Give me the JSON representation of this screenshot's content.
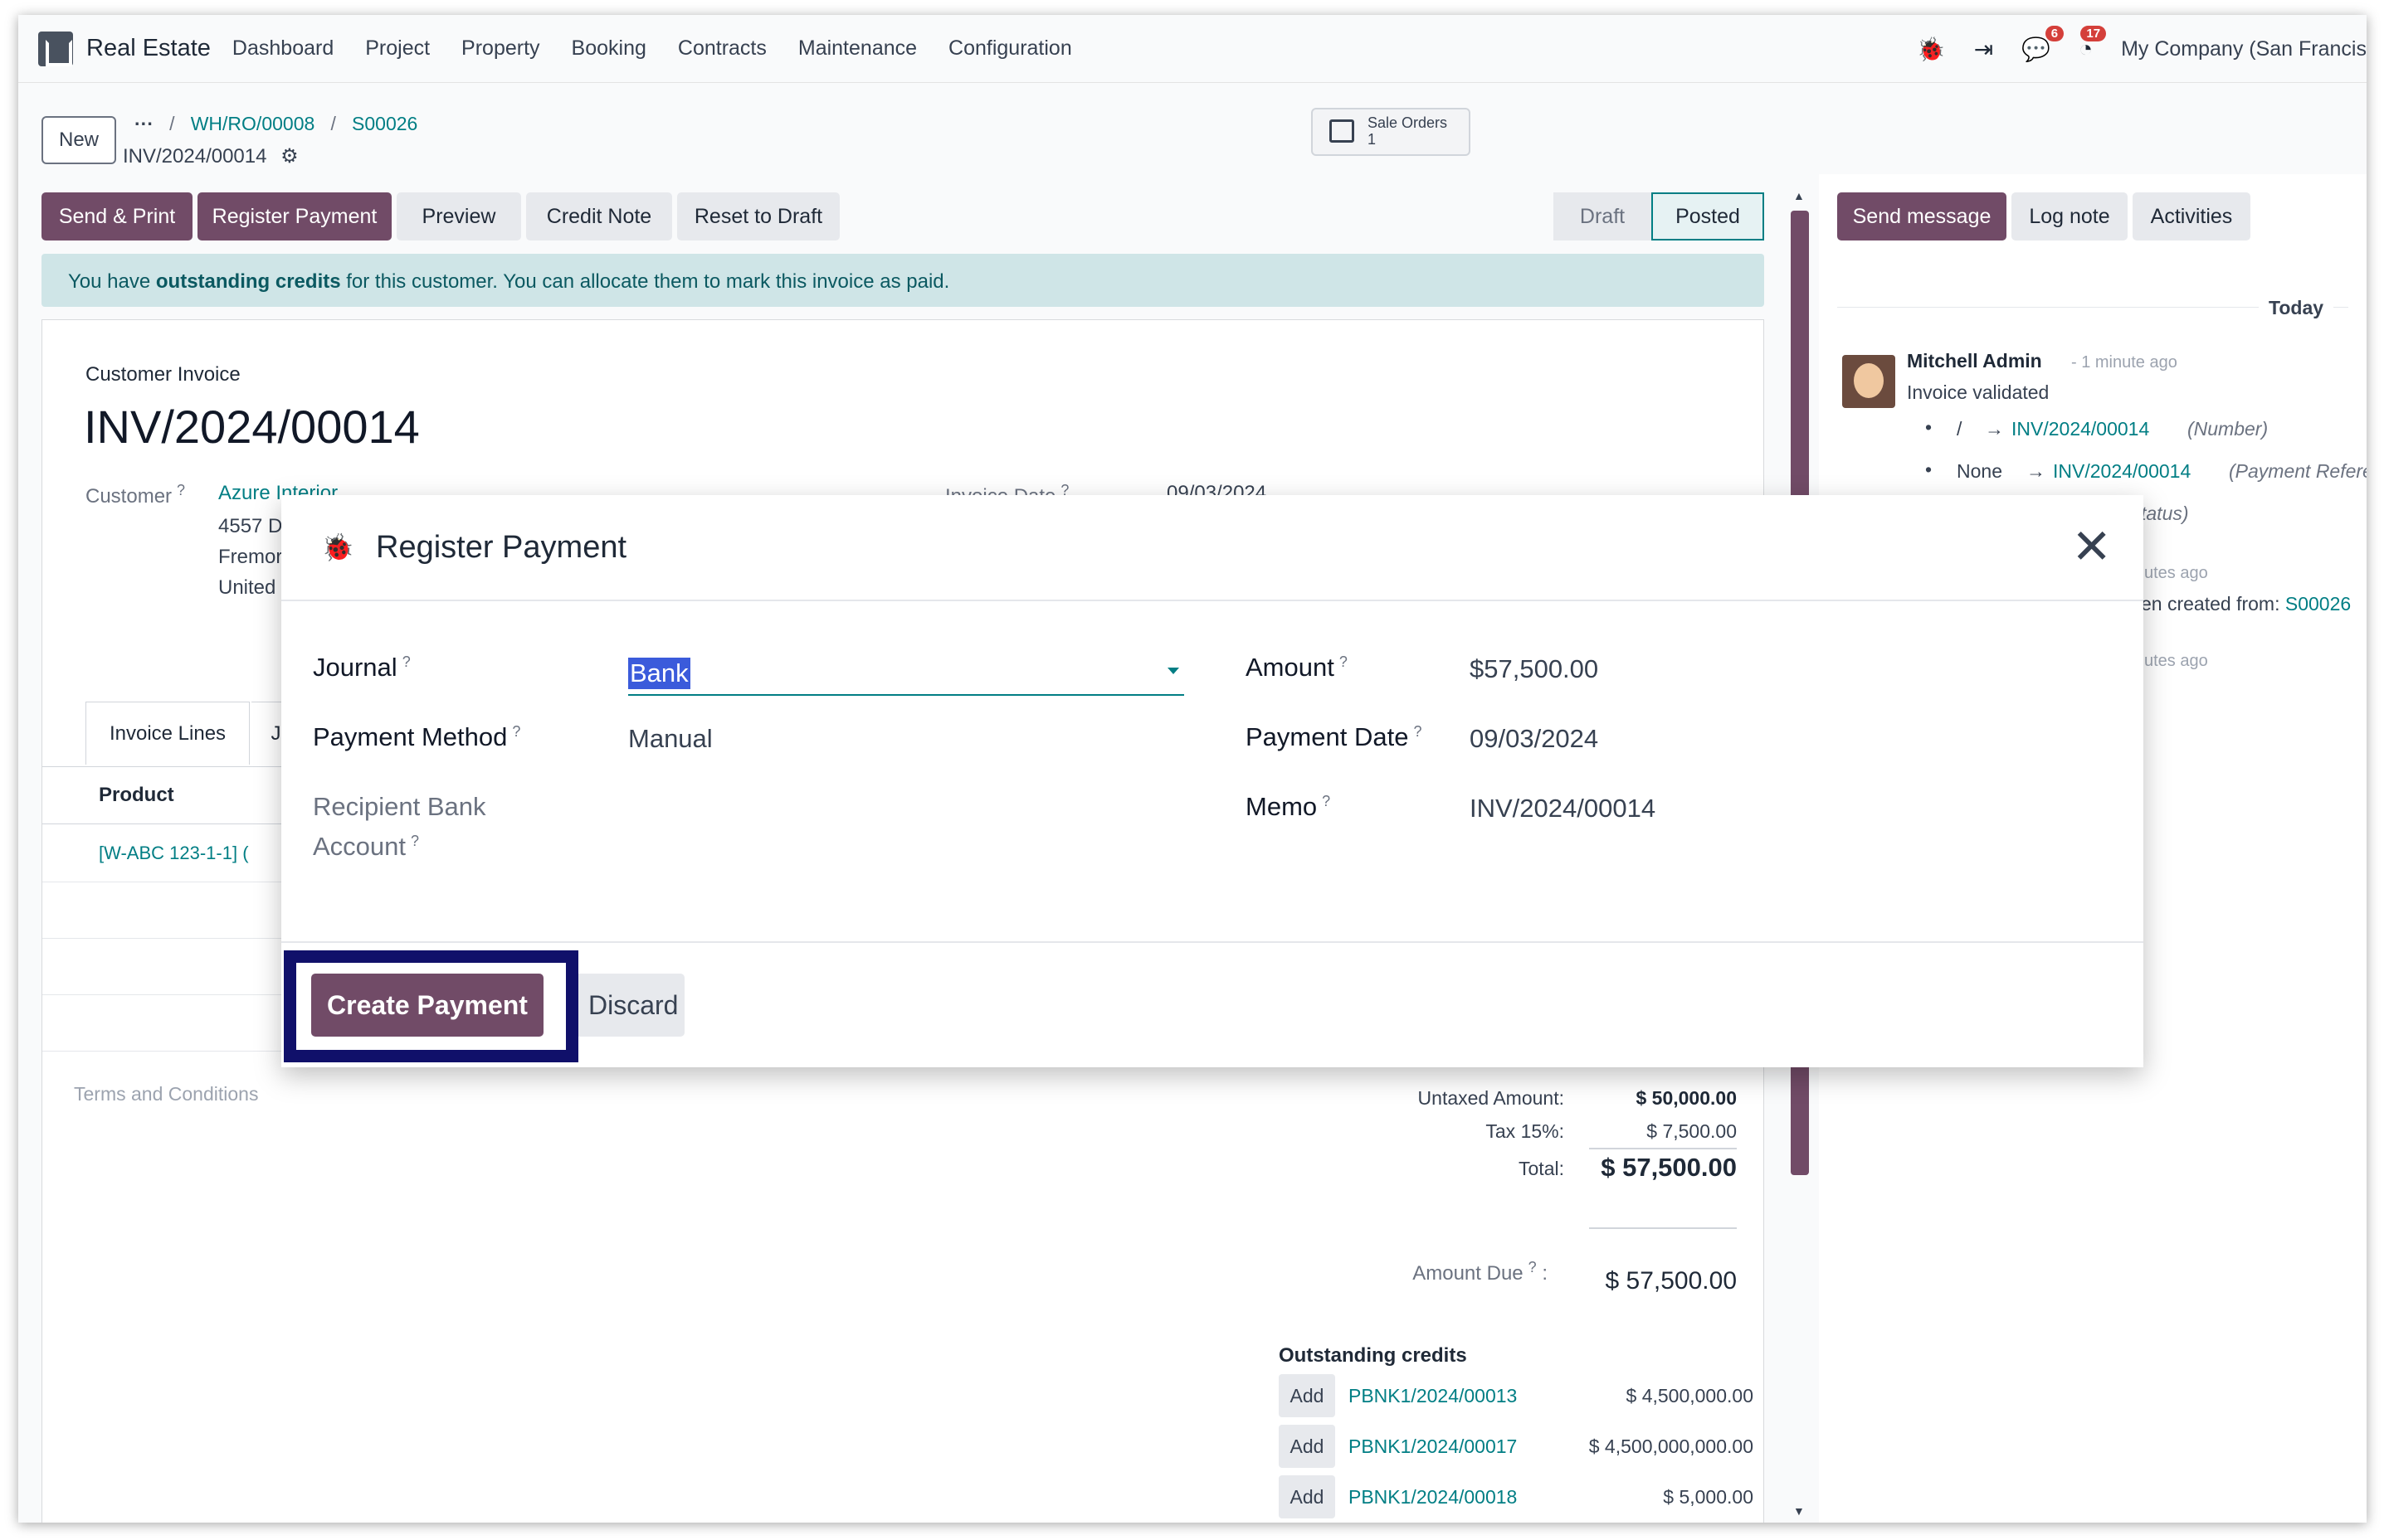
{
  "topnav": {
    "app_name": "Real Estate",
    "menu": [
      "Dashboard",
      "Project",
      "Property",
      "Booking",
      "Contracts",
      "Maintenance",
      "Configuration"
    ],
    "messages_count": "6",
    "activities_count": "17",
    "company": "My Company (San Francis"
  },
  "control": {
    "new_label": "New",
    "breadcrumb_ellipsis": "···",
    "breadcrumb": [
      "WH/RO/00008",
      "S00026"
    ],
    "current_record": "INV/2024/00014",
    "smart_button": {
      "label": "Sale Orders",
      "count": "1"
    }
  },
  "actions": {
    "send_print": "Send & Print",
    "register_payment": "Register Payment",
    "preview": "Preview",
    "credit_note": "Credit Note",
    "reset_to_draft": "Reset to Draft"
  },
  "statusbar": {
    "draft": "Draft",
    "posted": "Posted"
  },
  "alert": {
    "pre": "You have ",
    "bold": "outstanding credits",
    "post": " for this customer. You can allocate them to mark this invoice as paid."
  },
  "form": {
    "type_label": "Customer Invoice",
    "name": "INV/2024/00014",
    "customer_label": "Customer",
    "customer_name": "Azure Interior",
    "address_lines": [
      "4557 D",
      "Fremor",
      "United"
    ],
    "invoice_date_label": "Invoice Date",
    "invoice_date": "09/03/2024",
    "tab_invoice_lines": "Invoice Lines",
    "tab_other": "J",
    "col_product": "Product",
    "row1_product": "[W-ABC 123-1-1] (",
    "terms": "Terms and Conditions",
    "untaxed_label": "Untaxed Amount:",
    "untaxed_value": "$ 50,000.00",
    "tax_label": "Tax 15%:",
    "tax_value": "$ 7,500.00",
    "total_label": "Total:",
    "total_value": "$ 57,500.00",
    "amount_due_label": "Amount Due",
    "amount_due_value": "$ 57,500.00",
    "outstanding_title": "Outstanding credits",
    "outstanding": [
      {
        "add": "Add",
        "ref": "PBNK1/2024/00013",
        "amount": "$ 4,500,000.00"
      },
      {
        "add": "Add",
        "ref": "PBNK1/2024/00017",
        "amount": "$ 4,500,000,000.00"
      },
      {
        "add": "Add",
        "ref": "PBNK1/2024/00018",
        "amount": "$ 5,000.00"
      }
    ]
  },
  "chatter": {
    "send_message": "Send message",
    "log_note": "Log note",
    "activities": "Activities",
    "today": "Today",
    "author": "Mitchell Admin",
    "time": "- 1 minute ago",
    "message": "Invoice validated",
    "change1_old": "/",
    "change1_new": "INV/2024/00014",
    "change1_field": "(Number)",
    "change2_old": "None",
    "change2_new": "INV/2024/00014",
    "change2_field": "(Payment Referenc",
    "partial_status": "tatus)",
    "partial_time1": "utes ago",
    "partial_created": "en created from:",
    "partial_created_link": "S00026",
    "partial_time2": "utes ago"
  },
  "modal": {
    "title": "Register Payment",
    "journal_label": "Journal",
    "journal_value": "Bank",
    "payment_method_label": "Payment Method",
    "payment_method_value": "Manual",
    "recipient_label_1": "Recipient Bank",
    "recipient_label_2": "Account",
    "amount_label": "Amount",
    "amount_value": "$57,500.00",
    "payment_date_label": "Payment Date",
    "payment_date_value": "09/03/2024",
    "memo_label": "Memo",
    "memo_value": "INV/2024/00014",
    "create_payment": "Create Payment",
    "discard": "Discard",
    "help_mark": "?"
  },
  "colors": {
    "primary": "#714b67",
    "link": "#017e84",
    "highlight": "#10106a",
    "selection": "#3b5bdb"
  }
}
